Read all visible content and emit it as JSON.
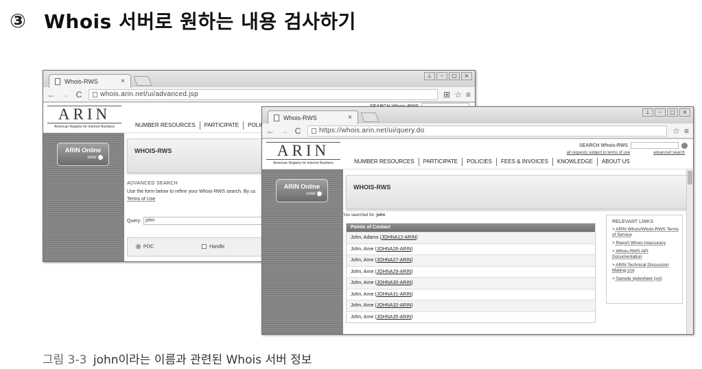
{
  "heading": {
    "number": "③",
    "text": "Whois 서버로 원하는 내용 검사하기"
  },
  "caption": {
    "figure": "그림 3-3",
    "text": "john이라는 이름과 관련된 Whois 서버 정보"
  },
  "window1": {
    "tab_title": "Whois-RWS",
    "url": "whois.arin.net/ui/advanced.jsp",
    "logo": {
      "word": "ARIN",
      "sub": "American Registry for Internet Numbers"
    },
    "search_label": "SEARCH Whois-RWS",
    "nav": [
      "NUMBER RESOURCES",
      "PARTICIPATE",
      "POLICIES"
    ],
    "sidebar_button": {
      "label": "ARIN Online",
      "sub": "enter"
    },
    "banner": "WHOIS-RWS",
    "advanced_title": "ADVANCED SEARCH",
    "advanced_desc": "Use the form below to refine your Whois-RWS search. By us",
    "terms": "Terms of Use",
    "query_label": "Query:",
    "query_value": "john",
    "options": [
      "POC",
      "Handle"
    ]
  },
  "window2": {
    "tab_title": "Whois-RWS",
    "url": "https://whois.arin.net/ui/query.do",
    "logo": {
      "word": "ARIN",
      "sub": "American Registry for Internet Numbers"
    },
    "search_label": "SEARCH Whois-RWS",
    "search_sub": [
      "all requests subject to terms of use",
      "advanced search"
    ],
    "nav": [
      "NUMBER RESOURCES",
      "PARTICIPATE",
      "POLICIES",
      "FEES & INVOICES",
      "KNOWLEDGE",
      "ABOUT US"
    ],
    "sidebar_button": {
      "label": "ARIN Online",
      "sub": "enter"
    },
    "banner": "WHOIS-RWS",
    "searched_prefix": "You searched for:",
    "searched_term": "john",
    "poc_title": "Points of Contact",
    "poc_rows": [
      {
        "name": "John, Adams",
        "handle": "JOHNA12-ARIN"
      },
      {
        "name": "John, Arne",
        "handle": "JOHNA26-ARIN"
      },
      {
        "name": "John, Arne",
        "handle": "JOHNA27-ARIN"
      },
      {
        "name": "John, Arne",
        "handle": "JOHNA29-ARIN"
      },
      {
        "name": "John, Arne",
        "handle": "JOHNA30-ARIN"
      },
      {
        "name": "John, Arne",
        "handle": "JOHNA31-ARIN"
      },
      {
        "name": "John, Arne",
        "handle": "JOHNA32-ARIN"
      },
      {
        "name": "John, Arne",
        "handle": "JOHNA35-ARIN"
      }
    ],
    "relevant_title": "RELEVANT LINKS",
    "relevant_links": [
      "ARIN Whois/Whois-RWS Terms of Service",
      "Report Whois Inaccuracy",
      "Whois-RWS API Documentation",
      "ARIN Technical Discussion Mailing List",
      "Sample stylesheet (xsl)"
    ]
  }
}
